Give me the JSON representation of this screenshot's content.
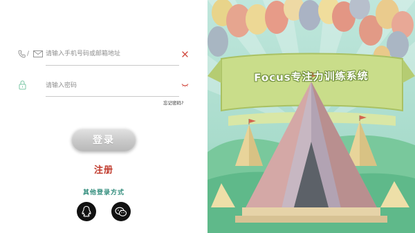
{
  "login_form": {
    "account_placeholder": "请输入手机号码或邮箱地址",
    "account_separator": "/",
    "password_placeholder": "请输入密码",
    "forgot_password": "忘记密码?",
    "login_button": "登录",
    "register_link": "注册",
    "other_methods_label": "其他登录方式"
  },
  "social_logins": [
    {
      "name": "qq",
      "icon": "qq-penguin-icon"
    },
    {
      "name": "wechat",
      "icon": "wechat-icon"
    }
  ],
  "icons": {
    "phone": "phone-icon",
    "mail": "mail-icon",
    "clear": "clear-x-icon",
    "lock": "lock-icon",
    "eye": "eye-closed-icon"
  },
  "banner": {
    "title": "Focus专注力训练系统"
  },
  "colors": {
    "accent_red": "#c0392b",
    "accent_teal": "#2e8b7a",
    "lock_green": "#7bc7a6",
    "login_button_gray": "#c9c9c9"
  }
}
